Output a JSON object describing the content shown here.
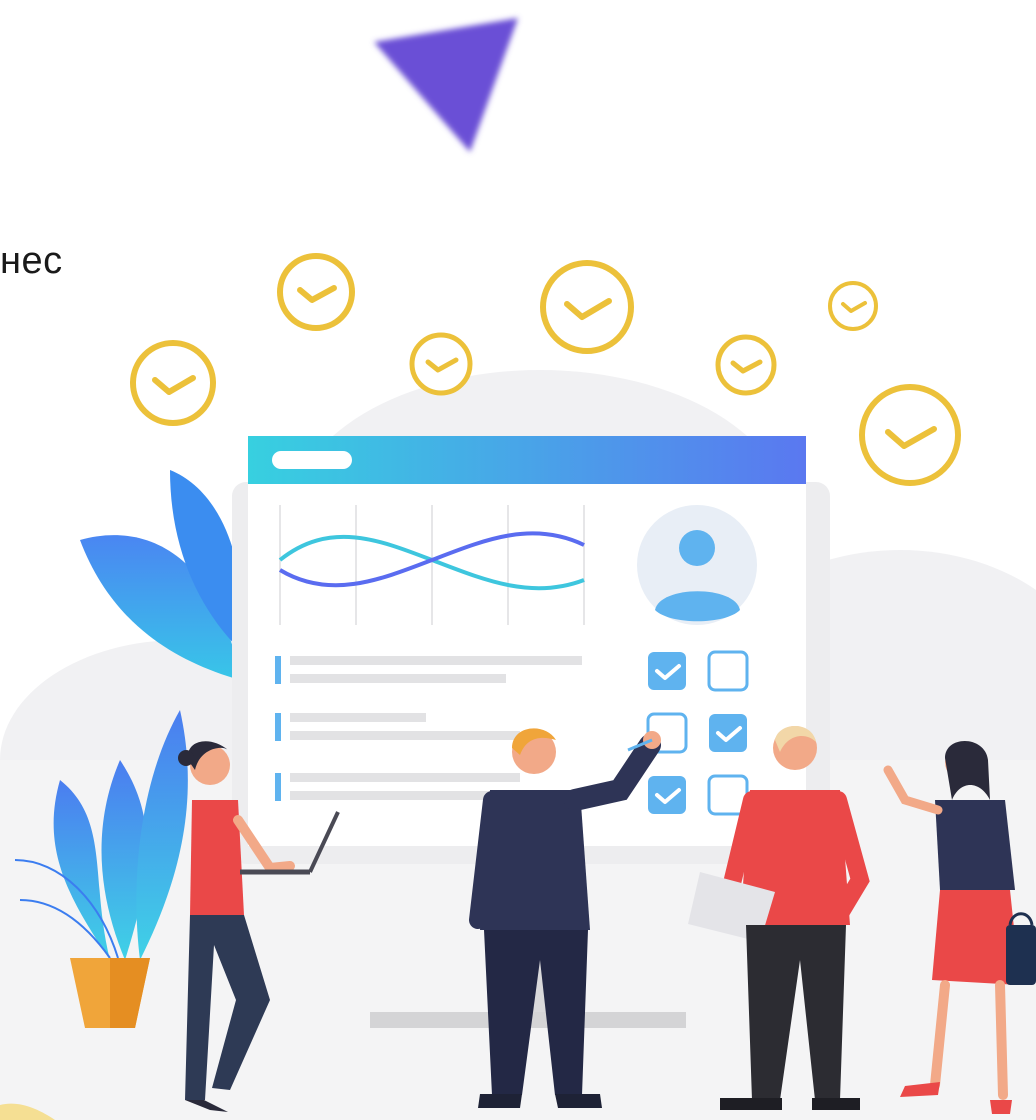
{
  "partial_heading": "нес",
  "colors": {
    "accent_purple": "#6a4fd6",
    "check_gold": "#ecc13a",
    "window_gradient_start": "#37d0e0",
    "window_gradient_end": "#5a78f0",
    "checkbox_blue": "#5fb3ef",
    "leaf_blue": "#3b8df0",
    "pot_orange": "#f0a53a",
    "shirt_red": "#ea4848",
    "suit_navy": "#2e3456"
  },
  "icons": [
    "triangle-icon",
    "check-circle-icon",
    "user-avatar-icon",
    "checkbox-checked-icon",
    "checkbox-empty-icon",
    "laptop-icon",
    "folder-icon",
    "handbag-icon"
  ],
  "checklist": {
    "rows": [
      {
        "left_checked": true,
        "right_checked": false
      },
      {
        "left_checked": false,
        "right_checked": true
      },
      {
        "left_checked": true,
        "right_checked": false
      }
    ]
  }
}
